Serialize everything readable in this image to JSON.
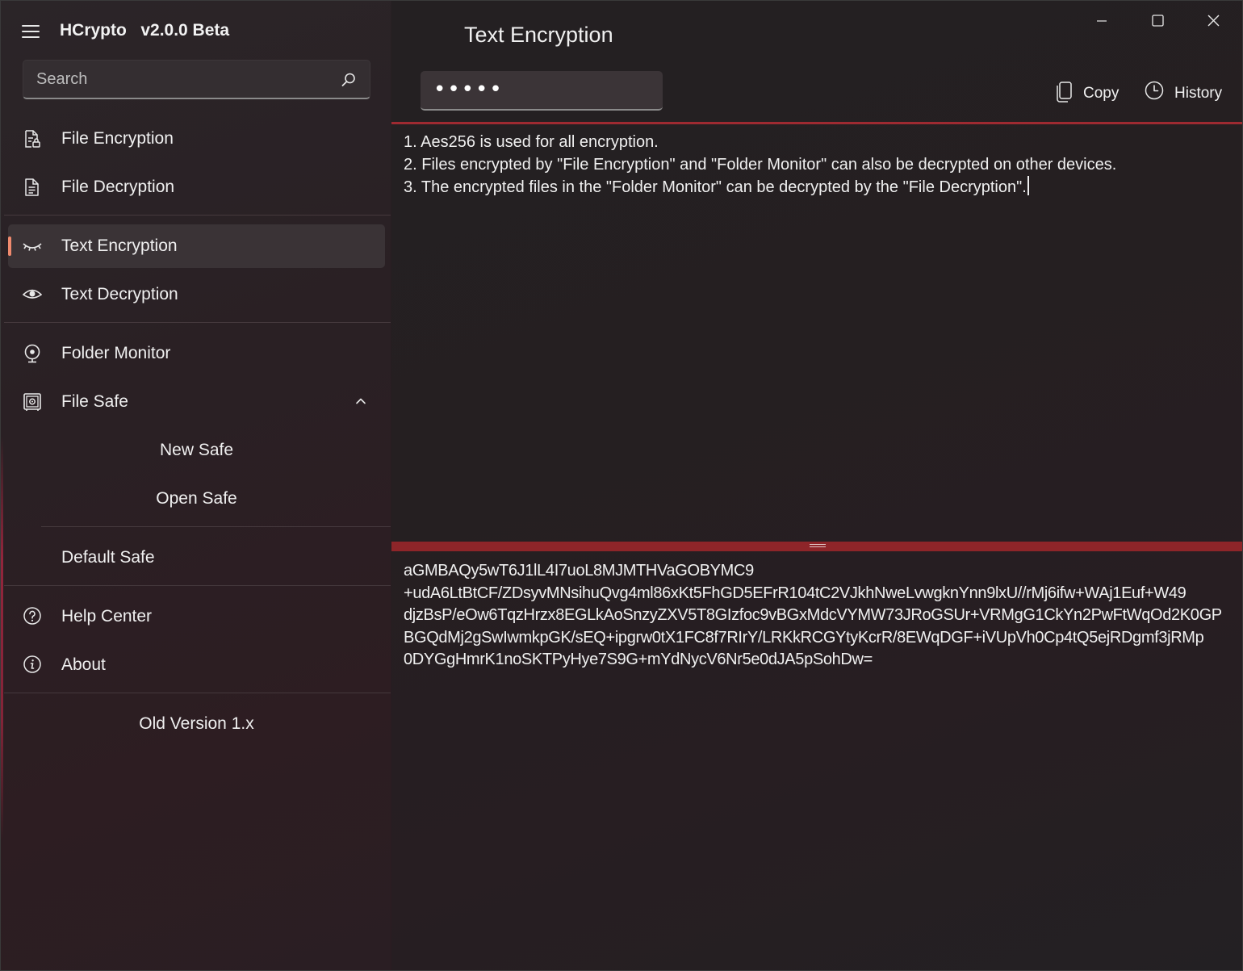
{
  "app": {
    "title": "HCrypto   v2.0.0 Beta"
  },
  "search": {
    "placeholder": "Search",
    "icon": "search-icon"
  },
  "sidebar": {
    "items": [
      {
        "label": "File Encryption",
        "icon": "file-lock-icon"
      },
      {
        "label": "File Decryption",
        "icon": "file-text-icon"
      },
      {
        "label": "Text Encryption",
        "icon": "eye-closed-icon",
        "selected": true
      },
      {
        "label": "Text Decryption",
        "icon": "eye-icon"
      },
      {
        "label": "Folder Monitor",
        "icon": "webcam-icon"
      },
      {
        "label": "File Safe",
        "icon": "safe-icon",
        "expanded": true
      },
      {
        "label": "New Safe"
      },
      {
        "label": "Open Safe"
      },
      {
        "label": "Default Safe"
      },
      {
        "label": "Help Center",
        "icon": "help-icon"
      },
      {
        "label": "About",
        "icon": "info-icon"
      },
      {
        "label": "Old Version 1.x"
      }
    ]
  },
  "main": {
    "title": "Text Encryption",
    "password_value": "•••••",
    "copy_label": "Copy",
    "history_label": "History",
    "input_lines": [
      "1. Aes256 is used for all encryption.",
      "2. Files encrypted by \"File Encryption\" and \"Folder Monitor\" can also be decrypted on other devices.",
      "3. The encrypted files in the \"Folder Monitor\" can be decrypted by the \"File Decryption\"."
    ],
    "output_lines": [
      "aGMBAQy5wT6J1lL4I7uoL8MJMTHVaGOBYMC9",
      "+udA6LtBtCF/ZDsyvMNsihuQvg4ml86xKt5FhGD5EFrR104tC2VJkhNweLvwgknYnn9lxU//rMj6ifw+WAj1Euf+W49",
      "djzBsP/eOw6TqzHrzx8EGLkAoSnzyZXV5T8GIzfoc9vBGxMdcVYMW73JRoGSUr+VRMgG1CkYn2PwFtWqOd2K0GP",
      "BGQdMj2gSwIwmkpGK/sEQ+ipgrw0tX1FC8f7RIrY/LRKkRCGYtyKcrR/8EWqDGF+iVUpVh0Cp4tQ5ejRDgmf3jRMp",
      "0DYGgHmrK1noSKTPyHye7S9G+mYdNycV6Nr5e0dJA5pSohDw="
    ]
  },
  "colors": {
    "accent_selected": "#f08a6e",
    "pane_separator": "#9e2a31"
  }
}
